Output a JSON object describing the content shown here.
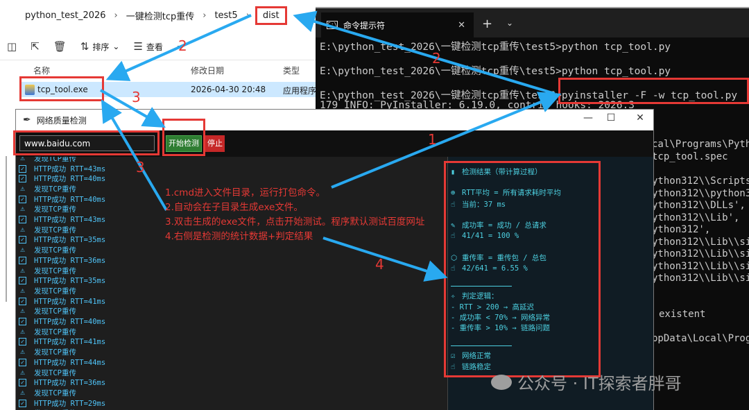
{
  "explorer": {
    "breadcrumb": [
      "python_test_2026",
      "一键检测tcp重传",
      "test5",
      "dist"
    ],
    "toolbar": {
      "sort": "排序",
      "view": "查看",
      "more": "···"
    },
    "columns": {
      "name": "名称",
      "modified": "修改日期",
      "type": "类型"
    },
    "file": {
      "name": "tcp_tool.exe",
      "modified": "2026-04-30 20:48",
      "type": "应用程序"
    }
  },
  "console": {
    "tab_title": "命令提示符",
    "lines": [
      "E:\\python_test_2026\\一键检测tcp重传\\test5>python tcp_tool.py",
      "E:\\python_test_2026\\一键检测tcp重传\\test5>python tcp_tool.py",
      "E:\\python_test_2026\\一键检测tcp重传\\test5>pyinstaller -F -w tcp_tool.py",
      "179 INFO: PyInstaller: 6.19.0, contrib hooks: 2026.3"
    ],
    "right_fragments": [
      "cal\\Programs\\Pyth",
      "tcp_tool.spec",
      "ython312\\\\Scripts",
      "ython312\\\\python3",
      "ython312\\\\DLLs',",
      "ython312\\\\Lib',",
      "ython312',",
      "ython312\\\\Lib\\\\si",
      "ython312\\\\Lib\\\\si",
      "ython312\\\\Lib\\\\si",
      "ython312\\\\Lib\\\\si",
      "existent",
      "ppData\\Local\\Prog"
    ]
  },
  "app": {
    "title": "网络质量检测",
    "url_value": "www.baidu.com",
    "start_label": "开始检测",
    "stop_label": "停止",
    "log": [
      {
        "icon": "warn",
        "text": "发现TCP重传"
      },
      {
        "icon": "check",
        "text": "HTTP成功 RTT=43ms"
      },
      {
        "icon": "check",
        "text": "HTTP成功 RTT=40ms"
      },
      {
        "icon": "warn",
        "text": "发现TCP重传"
      },
      {
        "icon": "check",
        "text": "HTTP成功 RTT=40ms"
      },
      {
        "icon": "warn",
        "text": "发现TCP重传"
      },
      {
        "icon": "check",
        "text": "HTTP成功 RTT=43ms"
      },
      {
        "icon": "warn",
        "text": "发现TCP重传"
      },
      {
        "icon": "check",
        "text": "HTTP成功 RTT=35ms"
      },
      {
        "icon": "warn",
        "text": "发现TCP重传"
      },
      {
        "icon": "check",
        "text": "HTTP成功 RTT=36ms"
      },
      {
        "icon": "warn",
        "text": "发现TCP重传"
      },
      {
        "icon": "check",
        "text": "HTTP成功 RTT=35ms"
      },
      {
        "icon": "warn",
        "text": "发现TCP重传"
      },
      {
        "icon": "check",
        "text": "HTTP成功 RTT=41ms"
      },
      {
        "icon": "warn",
        "text": "发现TCP重传"
      },
      {
        "icon": "check",
        "text": "HTTP成功 RTT=40ms"
      },
      {
        "icon": "warn",
        "text": "发现TCP重传"
      },
      {
        "icon": "check",
        "text": "HTTP成功 RTT=41ms"
      },
      {
        "icon": "warn",
        "text": "发现TCP重传"
      },
      {
        "icon": "check",
        "text": "HTTP成功 RTT=44ms"
      },
      {
        "icon": "warn",
        "text": "发现TCP重传"
      },
      {
        "icon": "check",
        "text": "HTTP成功 RTT=36ms"
      },
      {
        "icon": "warn",
        "text": "发现TCP重传"
      },
      {
        "icon": "check",
        "text": "HTTP成功 RTT=29ms"
      },
      {
        "icon": "warn",
        "text": "发现TCP重传"
      }
    ],
    "panel": {
      "title": "检测结果（带计算过程）",
      "rtt_formula": "RTT平均 = 所有请求耗时平均",
      "rtt_current": "当前：37 ms",
      "success_formula": "成功率 = 成功 / 总请求",
      "success_value": "41/41 = 100 %",
      "retrans_formula": "重传率 = 重传包 / 总包",
      "retrans_value": "42/641 = 6.55 %",
      "logic_title": "判定逻辑：",
      "logic_1": "- RTT > 200 → 高延迟",
      "logic_2": "- 成功率 < 70% → 网络异常",
      "logic_3": "- 重传率 > 10% → 链路问题",
      "result_1": "网络正常",
      "result_2": "链路稳定"
    }
  },
  "annotations": {
    "steps": [
      "1.cmd进入文件目录，运行打包命令。",
      "2.自动会在子目录生成exe文件。",
      "3.双击生成的exe文件，点击开始测试。程序默认测试百度网址",
      "4.右侧是检测的统计数据+判定结果"
    ],
    "numbers": [
      "2",
      "2",
      "3",
      "3",
      "1",
      "4"
    ]
  },
  "watermark": "公众号 · IT探索者胖哥",
  "colors": {
    "annotation_red": "#e53935",
    "arrow_blue": "#29a9f0",
    "console_bg": "#0c0c0c",
    "log_cyan": "#4fc3f7"
  }
}
